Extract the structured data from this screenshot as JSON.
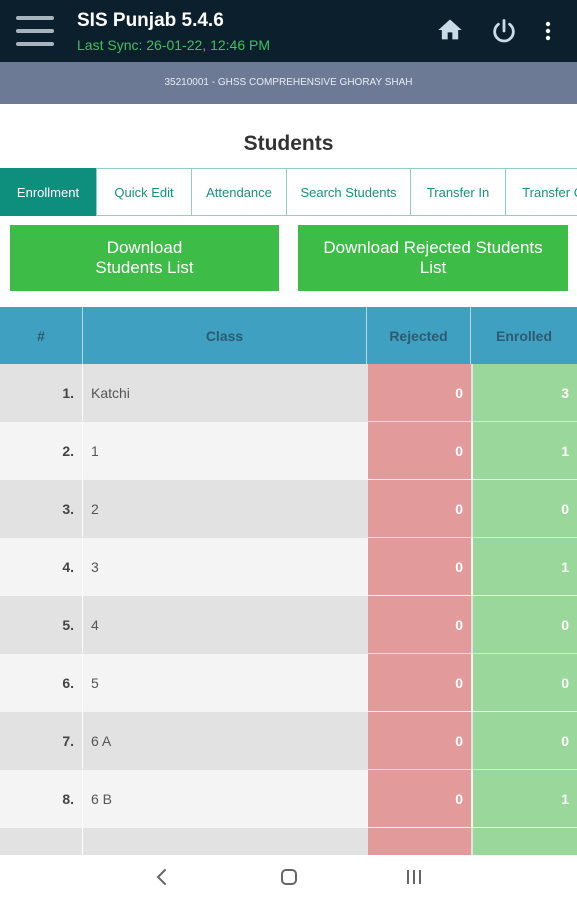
{
  "app": {
    "title": "SIS Punjab 5.4.6",
    "last_sync": "Last Sync: 26-01-22, 12:46 PM",
    "icons": [
      "hamburger-menu-icon",
      "home-icon",
      "power-icon",
      "more-vert-icon"
    ]
  },
  "school": {
    "name": "35210001 - GHSS COMPREHENSIVE GHORAY SHAH"
  },
  "page": {
    "title": "Students"
  },
  "tabs": [
    {
      "label": "Enrollment",
      "active": true
    },
    {
      "label": "Quick Edit",
      "active": false
    },
    {
      "label": "Attendance",
      "active": false
    },
    {
      "label": "Search Students",
      "active": false
    },
    {
      "label": "Transfer In",
      "active": false
    },
    {
      "label": "Transfer O",
      "active": false
    }
  ],
  "buttons": {
    "download_students": [
      "Download",
      "Students List"
    ],
    "download_rejected": [
      "Download Rejected Students",
      "List"
    ]
  },
  "table": {
    "headers": {
      "num": "#",
      "class": "Class",
      "rejected": "Rejected",
      "enrolled": "Enrolled"
    },
    "rows": [
      {
        "num": "1.",
        "class": "Katchi",
        "rejected": "0",
        "enrolled": "3"
      },
      {
        "num": "2.",
        "class": "1",
        "rejected": "0",
        "enrolled": "1"
      },
      {
        "num": "3.",
        "class": "2",
        "rejected": "0",
        "enrolled": "0"
      },
      {
        "num": "4.",
        "class": "3",
        "rejected": "0",
        "enrolled": "1"
      },
      {
        "num": "5.",
        "class": "4",
        "rejected": "0",
        "enrolled": "0"
      },
      {
        "num": "6.",
        "class": "5",
        "rejected": "0",
        "enrolled": "0"
      },
      {
        "num": "7.",
        "class": "6 A",
        "rejected": "0",
        "enrolled": "0"
      },
      {
        "num": "8.",
        "class": "6 B",
        "rejected": "0",
        "enrolled": "1"
      },
      {
        "num": "",
        "class": "",
        "rejected": "",
        "enrolled": ""
      }
    ]
  },
  "colors": {
    "appbar": "#0c1f2d",
    "sync_green": "#3fc05c",
    "school_strip": "#6d7a96",
    "tab_active": "#0e8f7d",
    "button_green": "#3ebc48",
    "table_header": "#3fa0c2",
    "rejected_cell": "#e39a9b",
    "enrolled_cell": "#9ad79a"
  },
  "system_nav": {
    "icons": [
      "back-icon",
      "home-circle-icon",
      "recent-apps-icon"
    ]
  }
}
